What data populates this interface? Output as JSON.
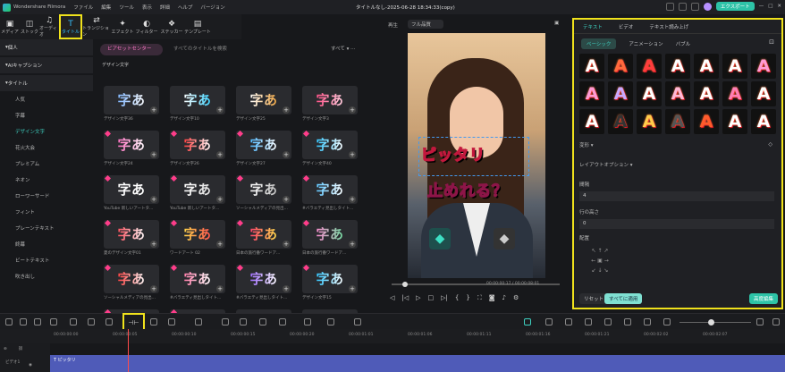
{
  "titlebar": {
    "app": "Wondershare Filmora",
    "menus": [
      "ファイル",
      "編集",
      "ツール",
      "表示",
      "詳細",
      "ヘルプ",
      "バージョン"
    ],
    "title": "タイトルなし-2025-06-28 18:34:33(copy)",
    "export": "エクスポート"
  },
  "media_toolbar": [
    {
      "label": "メディア",
      "glyph": "▣"
    },
    {
      "label": "ストック",
      "glyph": "◫"
    },
    {
      "label": "オーディオ",
      "glyph": "♫"
    },
    {
      "label": "タイトル",
      "glyph": "T"
    },
    {
      "label": "トランジション",
      "glyph": "⇄"
    },
    {
      "label": "エフェクト",
      "glyph": "✦"
    },
    {
      "label": "フィルター",
      "glyph": "◐"
    },
    {
      "label": "ステッカー",
      "glyph": "❖"
    },
    {
      "label": "テンプレート",
      "glyph": "▤"
    }
  ],
  "tree": [
    {
      "label": "個人",
      "type": "head"
    },
    {
      "label": "AIキャプション",
      "type": "head"
    },
    {
      "label": "タイトル",
      "type": "head"
    },
    {
      "label": "人気",
      "type": "sub"
    },
    {
      "label": "字幕",
      "type": "sub"
    },
    {
      "label": "デザイン文字",
      "type": "sel"
    },
    {
      "label": "花火大会",
      "type": "sub"
    },
    {
      "label": "プレミアム",
      "type": "sub"
    },
    {
      "label": "ネオン",
      "type": "sub"
    },
    {
      "label": "ローワーサード",
      "type": "sub"
    },
    {
      "label": "フィント",
      "type": "sub"
    },
    {
      "label": "プレーンテキスト",
      "type": "sub"
    },
    {
      "label": "終幕",
      "type": "sub"
    },
    {
      "label": "ビートテキスト",
      "type": "sub"
    },
    {
      "label": "吹き出し",
      "type": "sub"
    }
  ],
  "gridpanel": {
    "chip": "ビアセットセンター",
    "search_placeholder": "すべてのタイトルを検索",
    "filter": "すべて",
    "section": "デザイン文字",
    "cells": [
      {
        "label": "デザイン文字36",
        "text": "字あ",
        "c1": "#7fb6ff",
        "c2": "#ffffff",
        "gem": false
      },
      {
        "label": "デザイン文字10",
        "text": "字あ",
        "c1": "#ffffff",
        "c2": "#35d1ff",
        "gem": false
      },
      {
        "label": "デザイン文字25",
        "text": "字あ",
        "c1": "#ffffff",
        "c2": "#f0a23a",
        "gem": false
      },
      {
        "label": "デザイン文字3",
        "text": "字あ",
        "c1": "#ff4f86",
        "c2": "#ffd1e0",
        "gem": false
      },
      {
        "label": "デザイン文字24",
        "text": "字あ",
        "c1": "#ff6fc2",
        "c2": "#ffffff",
        "gem": true
      },
      {
        "label": "デザイン文字26",
        "text": "字あ",
        "c1": "#ff3a3a",
        "c2": "#ffffff",
        "gem": true
      },
      {
        "label": "デザイン文字27",
        "text": "字あ",
        "c1": "#4bb7ff",
        "c2": "#ffffff",
        "gem": true
      },
      {
        "label": "デザイン文字40",
        "text": "字あ",
        "c1": "#2ec5ff",
        "c2": "#ffffff",
        "gem": true
      },
      {
        "label": "YouTube 新しいアートタ...",
        "text": "字あ",
        "c1": "#ffffff",
        "c2": "#ffffff",
        "gem": true
      },
      {
        "label": "YouTube 新しいアートタ...",
        "text": "字あ",
        "c1": "#ffffff",
        "c2": "#dddddd",
        "gem": true
      },
      {
        "label": "ソーシャルメディアの見出...",
        "text": "字あ",
        "c1": "#ffffff",
        "c2": "#bbbbbb",
        "gem": true
      },
      {
        "label": "#バラエティ見出しタイト...",
        "text": "字あ",
        "c1": "#5cc6ff",
        "c2": "#ffffff",
        "gem": true
      },
      {
        "label": "夏のデザイン文字01",
        "text": "字あ",
        "c1": "#ff4d5b",
        "c2": "#ffffff",
        "gem": true
      },
      {
        "label": "ワードアート 02",
        "text": "字あ",
        "c1": "#ffd84a",
        "c2": "#ff4e4e",
        "gem": true
      },
      {
        "label": "日本の旅行番ワードア...",
        "text": "字あ",
        "c1": "#ff3d6b",
        "c2": "#ffe14a",
        "gem": true
      },
      {
        "label": "日本の旅行番ワードア...",
        "text": "字あ",
        "c1": "#ff8ad1",
        "c2": "#6ee0a0",
        "gem": true
      },
      {
        "label": "ソーシャルメディアの見出...",
        "text": "字あ",
        "c1": "#ff3d3d",
        "c2": "#ffffff",
        "gem": true
      },
      {
        "label": "#バラエティ見出しタイト...",
        "text": "字あ",
        "c1": "#ff7aa8",
        "c2": "#ffffff",
        "gem": true
      },
      {
        "label": "#バラエティ見出しタイト...",
        "text": "字あ",
        "c1": "#9f6bff",
        "c2": "#ffffff",
        "gem": true
      },
      {
        "label": "デザイン文字15",
        "text": "字あ",
        "c1": "#2ec5ff",
        "c2": "#ffffff",
        "gem": true
      },
      {
        "label": "",
        "text": "字あ",
        "c1": "#ff6a3d",
        "c2": "#ffd84a",
        "gem": true
      },
      {
        "label": "",
        "text": "字あ",
        "c1": "#ffd84a",
        "c2": "#ffffff",
        "gem": true
      },
      {
        "label": "",
        "text": "字 あ",
        "c1": "#ffffff",
        "c2": "#ffffff",
        "gem": false
      },
      {
        "label": "",
        "text": "字あ",
        "c1": "#ffffff",
        "c2": "#6ac9ff",
        "gem": false
      }
    ]
  },
  "preview": {
    "label": "再生",
    "quality": "フル品質",
    "caption1": "ピッタリ",
    "caption2": "止めれる？",
    "time": "00:00:00:17 / 00:00:08:01"
  },
  "rightpanel": {
    "tabs": [
      "テキスト",
      "ビデオ",
      "テキスト読み上げ"
    ],
    "subtabs": [
      "ベーシック",
      "アニメーション",
      "バブル"
    ],
    "presets": [
      [
        "#ffffff",
        "#ff6a3d",
        "#ff3d3d",
        "#ffffff",
        "#ffffff",
        "#ffffff",
        "#ff9ad5"
      ],
      [
        "#ff9ad5",
        "#c9a8ff",
        "#ffffff",
        "#ffb8d6",
        "#ffffff",
        "#ff7fb6",
        "#ffffff"
      ],
      [
        "#ffffff",
        "#333333",
        "#ffcc4a",
        "#555555",
        "#ff5b2b",
        "#ffffff",
        "#ffffff"
      ]
    ],
    "preset_char": "A",
    "transform": "変形",
    "layout": "レイアウトオプション",
    "spacing": "間隔",
    "spacing_val": "4",
    "line_spacing": "行の高さ",
    "line_val": "0",
    "align": "配置",
    "reset": "リセット",
    "apply_all": "すべてに適用",
    "advanced": "高度編集"
  },
  "timeline": {
    "ticks": [
      "00:00:00:00",
      "00:00:00:05",
      "00:00:00:10",
      "00:00:00:15",
      "00:00:00:20",
      "00:00:01:01",
      "00:00:01:06",
      "00:00:01:11",
      "00:00:01:16",
      "00:00:01:21",
      "00:00:02:02",
      "00:00:02:07"
    ],
    "clip": "ピッタリ",
    "track": "ビデオ1"
  },
  "colors": {
    "accent": "#3ed0c0",
    "highlight": "#f0e21c",
    "clip": "#4f5bb8",
    "playhead": "#ff4b4b"
  }
}
